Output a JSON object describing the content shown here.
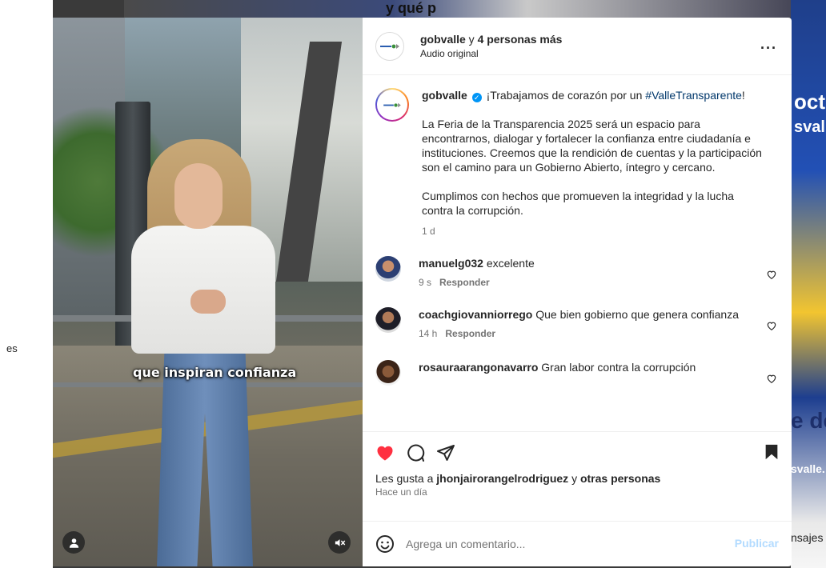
{
  "background": {
    "left_text": "es",
    "top_title": "y qué p",
    "right_texts": [
      "octu",
      "svall",
      "e de",
      "svalle."
    ],
    "right_messages": "nsajes"
  },
  "video": {
    "subtitle": "que inspiran confianza",
    "icons": [
      "user-icon",
      "muted-icon"
    ]
  },
  "header": {
    "username": "gobvalle",
    "connector": " y ",
    "others": "4 personas más",
    "audio": "Audio original",
    "more": "···"
  },
  "caption": {
    "username": "gobvalle",
    "text_before": " ¡Trabajamos de corazón por un ",
    "hashtag": "#ValleTransparente",
    "text_after": "!",
    "paragraph1": "La Feria de la Transparencia 2025 será un espacio para encontrarnos, dialogar y fortalecer la confianza entre ciudadanía e instituciones. Creemos que la rendición de cuentas y la participación son el camino para un Gobierno Abierto, íntegro y cercano.",
    "paragraph2": "Cumplimos con hechos que promueven la integridad y la lucha contra la corrupción.",
    "time": "1 d"
  },
  "comments": [
    {
      "username": "manuelg032",
      "text": " excelente",
      "time": "9 s",
      "reply": "Responder"
    },
    {
      "username": "coachgiovanniorrego",
      "text": " Que bien gobierno que genera confianza",
      "time": "14 h",
      "reply": "Responder"
    },
    {
      "username": "rosauraarangonavarro",
      "text": " Gran labor contra la corrupción",
      "time": "",
      "reply": ""
    }
  ],
  "actions": {
    "likes_prefix": "Les gusta a ",
    "likes_user": "jhonjairorangelrodriguez",
    "likes_middle": " y ",
    "likes_others": "otras personas",
    "when": "Hace un día"
  },
  "add_comment": {
    "placeholder": "Agrega un comentario...",
    "publish": "Publicar"
  },
  "colors": {
    "like_red": "#ff3040",
    "link_blue": "#00376b",
    "verified_blue": "#0095f6",
    "publish_disabled": "#b3dbff"
  }
}
